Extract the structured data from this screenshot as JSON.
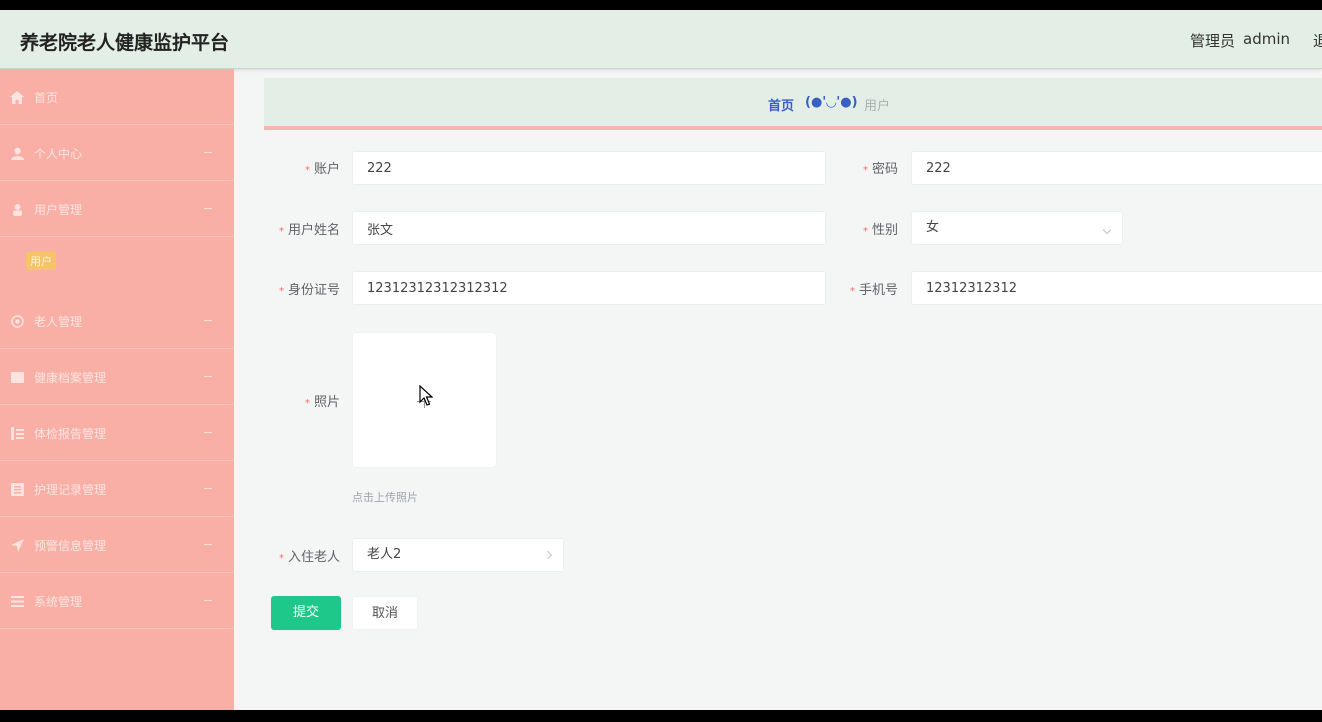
{
  "header": {
    "title": "养老院老人健康监护平台",
    "role": "管理员",
    "username": "admin",
    "logout": "退"
  },
  "sidebar": {
    "items": [
      {
        "label": "首页",
        "icon": "home-icon"
      },
      {
        "label": "个人中心",
        "icon": "user-icon"
      },
      {
        "label": "用户管理",
        "icon": "users-icon"
      },
      {
        "label": "老人管理",
        "icon": "elder-icon"
      },
      {
        "label": "健康档案管理",
        "icon": "record-icon"
      },
      {
        "label": "体检报告管理",
        "icon": "report-icon"
      },
      {
        "label": "护理记录管理",
        "icon": "nursing-icon"
      },
      {
        "label": "预警信息管理",
        "icon": "alert-icon"
      },
      {
        "label": "系统管理",
        "icon": "settings-icon"
      }
    ],
    "sub_item": "用户"
  },
  "breadcrumb": {
    "home": "首页",
    "separator": "(●'◡'●)",
    "current": "用户"
  },
  "form": {
    "account": {
      "label": "账户",
      "value": "222"
    },
    "password": {
      "label": "密码",
      "value": "222"
    },
    "name": {
      "label": "用户姓名",
      "value": "张文"
    },
    "gender": {
      "label": "性别",
      "value": "女"
    },
    "id_card": {
      "label": "身份证号",
      "value": "12312312312312312"
    },
    "phone": {
      "label": "手机号",
      "value": "12312312312"
    },
    "photo": {
      "label": "照片",
      "tip": "点击上传照片"
    },
    "elder": {
      "label": "入住老人",
      "value": "老人2"
    }
  },
  "buttons": {
    "submit": "提交",
    "cancel": "取消"
  },
  "colors": {
    "sidebar_bg": "#faafa6",
    "header_bg": "#e3efe6",
    "primary": "#1ec78a",
    "active_sub": "#f6c26b"
  }
}
